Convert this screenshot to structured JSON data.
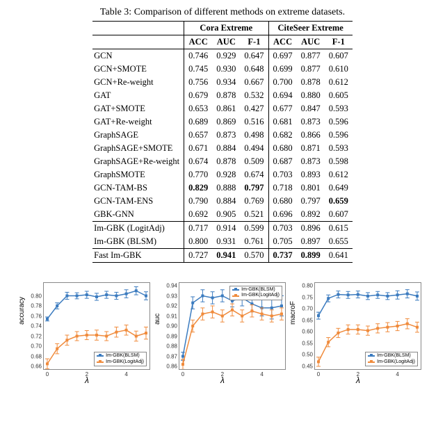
{
  "table": {
    "caption": "Table 3: Comparison of different methods on extreme datasets.",
    "group_blank": "",
    "group1": "Cora Extreme",
    "group2": "CiteSeer Extreme",
    "cols": [
      "ACC",
      "AUC",
      "F-1",
      "ACC",
      "AUC",
      "F-1"
    ],
    "sections": [
      [
        {
          "m": "GCN",
          "v": [
            "0.746",
            "0.929",
            "0.647",
            "0.697",
            "0.877",
            "0.607"
          ]
        },
        {
          "m": "GCN+SMOTE",
          "v": [
            "0.745",
            "0.930",
            "0.648",
            "0.699",
            "0.877",
            "0.610"
          ]
        },
        {
          "m": "GCN+Re-weight",
          "v": [
            "0.756",
            "0.934",
            "0.667",
            "0.700",
            "0.878",
            "0.612"
          ]
        },
        {
          "m": "GAT",
          "v": [
            "0.679",
            "0.878",
            "0.532",
            "0.694",
            "0.880",
            "0.605"
          ]
        },
        {
          "m": "GAT+SMOTE",
          "v": [
            "0.653",
            "0.861",
            "0.427",
            "0.677",
            "0.847",
            "0.593"
          ]
        },
        {
          "m": "GAT+Re-weight",
          "v": [
            "0.689",
            "0.869",
            "0.516",
            "0.681",
            "0.873",
            "0.596"
          ]
        },
        {
          "m": "GraphSAGE",
          "v": [
            "0.657",
            "0.873",
            "0.498",
            "0.682",
            "0.866",
            "0.596"
          ]
        },
        {
          "m": "GraphSAGE+SMOTE",
          "v": [
            "0.671",
            "0.884",
            "0.494",
            "0.680",
            "0.871",
            "0.593"
          ]
        },
        {
          "m": "GraphSAGE+Re-weight",
          "v": [
            "0.674",
            "0.878",
            "0.509",
            "0.687",
            "0.873",
            "0.598"
          ]
        },
        {
          "m": "GraphSMOTE",
          "v": [
            "0.770",
            "0.928",
            "0.674",
            "0.703",
            "0.893",
            "0.612"
          ]
        },
        {
          "m": "GCN-TAM-BS",
          "v": [
            "0.829",
            "0.888",
            "0.797",
            "0.718",
            "0.801",
            "0.649"
          ],
          "bold": [
            0,
            2
          ]
        },
        {
          "m": "GCN-TAM-ENS",
          "v": [
            "0.790",
            "0.884",
            "0.769",
            "0.680",
            "0.797",
            "0.659"
          ],
          "bold": [
            5
          ]
        },
        {
          "m": "GBK-GNN",
          "v": [
            "0.692",
            "0.905",
            "0.521",
            "0.696",
            "0.892",
            "0.607"
          ]
        }
      ],
      [
        {
          "m": "Im-GBK (LogitAdj)",
          "v": [
            "0.717",
            "0.914",
            "0.599",
            "0.703",
            "0.896",
            "0.615"
          ]
        },
        {
          "m": "Im-GBK (BLSM)",
          "v": [
            "0.800",
            "0.931",
            "0.761",
            "0.705",
            "0.897",
            "0.655"
          ]
        }
      ],
      [
        {
          "m": "Fast Im-GBK",
          "v": [
            "0.727",
            "0.941",
            "0.570",
            "0.737",
            "0.899",
            "0.641"
          ],
          "bold": [
            1,
            3,
            4
          ]
        }
      ]
    ]
  },
  "legend": {
    "s1": "Im-GBK(BLSM)",
    "s2": "Im-GBK(LogitAdj)"
  },
  "charts": [
    {
      "ylabel": "accuracy",
      "xlabel": "λ",
      "ymin": 0.66,
      "ymax": 0.82,
      "yticks": [
        "0.66",
        "0.68",
        "0.70",
        "0.72",
        "0.74",
        "0.76",
        "0.78",
        "0.80"
      ],
      "xticks": [
        "0",
        "2",
        "4"
      ],
      "legend_pos": "br",
      "x": [
        0,
        0.5,
        1,
        1.5,
        2,
        2.5,
        3,
        3.5,
        4,
        4.5,
        5
      ],
      "series": [
        {
          "name": "Im-GBK(BLSM)",
          "color": "#3b7bbf",
          "y": [
            0.754,
            0.78,
            0.8,
            0.8,
            0.802,
            0.798,
            0.802,
            0.8,
            0.804,
            0.81,
            0.8
          ],
          "err": [
            0.004,
            0.006,
            0.007,
            0.006,
            0.007,
            0.007,
            0.007,
            0.007,
            0.008,
            0.008,
            0.008
          ]
        },
        {
          "name": "Im-GBK(LogitAdj)",
          "color": "#f08b3c",
          "y": [
            0.665,
            0.695,
            0.712,
            0.72,
            0.722,
            0.722,
            0.72,
            0.728,
            0.732,
            0.72,
            0.726
          ],
          "err": [
            0.01,
            0.01,
            0.01,
            0.009,
            0.009,
            0.01,
            0.009,
            0.01,
            0.01,
            0.01,
            0.012
          ]
        }
      ]
    },
    {
      "ylabel": "auc",
      "xlabel": "λ",
      "ymin": 0.86,
      "ymax": 0.94,
      "yticks": [
        "0.86",
        "0.87",
        "0.88",
        "0.89",
        "0.90",
        "0.91",
        "0.92",
        "0.93",
        "0.94"
      ],
      "xticks": [
        "0",
        "2",
        "4"
      ],
      "legend_pos": "tr",
      "x": [
        0,
        0.5,
        1,
        1.5,
        2,
        2.5,
        3,
        3.5,
        4,
        4.5,
        5
      ],
      "series": [
        {
          "name": "Im-GBK(BLSM)",
          "color": "#3b7bbf",
          "y": [
            0.87,
            0.923,
            0.93,
            0.928,
            0.93,
            0.925,
            0.928,
            0.922,
            0.918,
            0.918,
            0.92
          ],
          "err": [
            0.004,
            0.006,
            0.006,
            0.006,
            0.006,
            0.006,
            0.008,
            0.008,
            0.008,
            0.011,
            0.01
          ]
        },
        {
          "name": "Im-GBK(LogitAdj)",
          "color": "#f08b3c",
          "y": [
            0.862,
            0.9,
            0.912,
            0.914,
            0.91,
            0.916,
            0.91,
            0.915,
            0.912,
            0.91,
            0.912
          ],
          "err": [
            0.005,
            0.006,
            0.006,
            0.006,
            0.006,
            0.006,
            0.006,
            0.006,
            0.006,
            0.006,
            0.006
          ]
        }
      ]
    },
    {
      "ylabel": "macroF",
      "xlabel": "λ",
      "ymin": 0.45,
      "ymax": 0.8,
      "yticks": [
        "0.45",
        "0.50",
        "0.55",
        "0.60",
        "0.65",
        "0.70",
        "0.75",
        "0.80"
      ],
      "xticks": [
        "0",
        "2",
        "4"
      ],
      "legend_pos": "br",
      "x": [
        0,
        0.5,
        1,
        1.5,
        2,
        2.5,
        3,
        3.5,
        4,
        4.5,
        5
      ],
      "series": [
        {
          "name": "Im-GBK(BLSM)",
          "color": "#3b7bbf",
          "y": [
            0.67,
            0.745,
            0.762,
            0.76,
            0.762,
            0.755,
            0.76,
            0.755,
            0.76,
            0.765,
            0.755
          ],
          "err": [
            0.015,
            0.015,
            0.015,
            0.015,
            0.015,
            0.015,
            0.015,
            0.015,
            0.018,
            0.018,
            0.018
          ]
        },
        {
          "name": "Im-GBK(LogitAdj)",
          "color": "#f08b3c",
          "y": [
            0.47,
            0.555,
            0.595,
            0.61,
            0.61,
            0.605,
            0.615,
            0.62,
            0.625,
            0.635,
            0.62
          ],
          "err": [
            0.02,
            0.02,
            0.02,
            0.02,
            0.02,
            0.02,
            0.02,
            0.02,
            0.02,
            0.022,
            0.022
          ]
        }
      ]
    }
  ],
  "chart_data": [
    {
      "type": "line",
      "title": "",
      "xlabel": "λ",
      "ylabel": "accuracy",
      "xlim": [
        0,
        5
      ],
      "ylim": [
        0.66,
        0.82
      ],
      "x": [
        0,
        0.5,
        1,
        1.5,
        2,
        2.5,
        3,
        3.5,
        4,
        4.5,
        5
      ],
      "series": [
        {
          "name": "Im-GBK(BLSM)",
          "values": [
            0.754,
            0.78,
            0.8,
            0.8,
            0.802,
            0.798,
            0.802,
            0.8,
            0.804,
            0.81,
            0.8
          ]
        },
        {
          "name": "Im-GBK(LogitAdj)",
          "values": [
            0.665,
            0.695,
            0.712,
            0.72,
            0.722,
            0.722,
            0.72,
            0.728,
            0.732,
            0.72,
            0.726
          ]
        }
      ]
    },
    {
      "type": "line",
      "title": "",
      "xlabel": "λ",
      "ylabel": "auc",
      "xlim": [
        0,
        5
      ],
      "ylim": [
        0.86,
        0.94
      ],
      "x": [
        0,
        0.5,
        1,
        1.5,
        2,
        2.5,
        3,
        3.5,
        4,
        4.5,
        5
      ],
      "series": [
        {
          "name": "Im-GBK(BLSM)",
          "values": [
            0.87,
            0.923,
            0.93,
            0.928,
            0.93,
            0.925,
            0.928,
            0.922,
            0.918,
            0.918,
            0.92
          ]
        },
        {
          "name": "Im-GBK(LogitAdj)",
          "values": [
            0.862,
            0.9,
            0.912,
            0.914,
            0.91,
            0.916,
            0.91,
            0.915,
            0.912,
            0.91,
            0.912
          ]
        }
      ]
    },
    {
      "type": "line",
      "title": "",
      "xlabel": "λ",
      "ylabel": "macroF",
      "xlim": [
        0,
        5
      ],
      "ylim": [
        0.45,
        0.8
      ],
      "x": [
        0,
        0.5,
        1,
        1.5,
        2,
        2.5,
        3,
        3.5,
        4,
        4.5,
        5
      ],
      "series": [
        {
          "name": "Im-GBK(BLSM)",
          "values": [
            0.67,
            0.745,
            0.762,
            0.76,
            0.762,
            0.755,
            0.76,
            0.755,
            0.76,
            0.765,
            0.755
          ]
        },
        {
          "name": "Im-GBK(LogitAdj)",
          "values": [
            0.47,
            0.555,
            0.595,
            0.61,
            0.61,
            0.605,
            0.615,
            0.62,
            0.625,
            0.635,
            0.62
          ]
        }
      ]
    }
  ]
}
